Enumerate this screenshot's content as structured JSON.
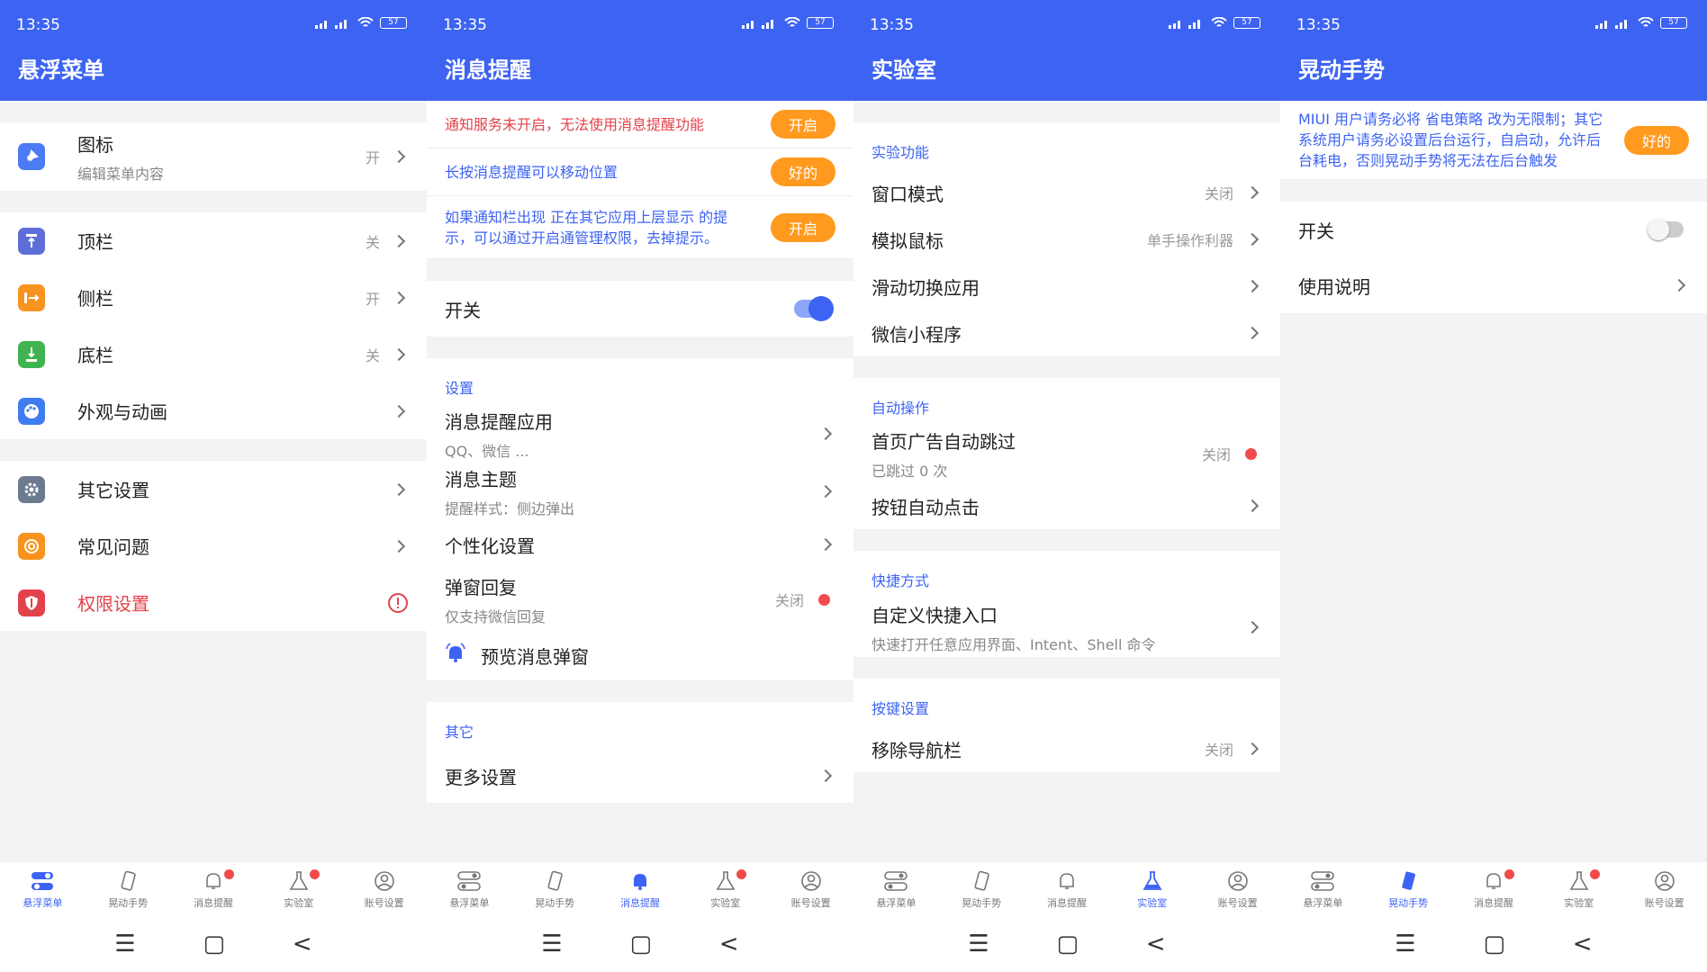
{
  "status_bar": {
    "time": "13:35",
    "battery": "57"
  },
  "colors": {
    "primary": "#3d63f3",
    "orange": "#ff9a1f",
    "red": "#f04a4a",
    "background": "#f2f3f5"
  },
  "bottom_nav": {
    "items": [
      {
        "label": "悬浮菜单",
        "icon": "toggle-menu-icon"
      },
      {
        "label": "晃动手势",
        "icon": "phone-shake-icon"
      },
      {
        "label": "消息提醒",
        "icon": "bell-icon"
      },
      {
        "label": "实验室",
        "icon": "flask-icon"
      },
      {
        "label": "账号设置",
        "icon": "account-icon"
      }
    ]
  },
  "system_nav": {
    "menu": "☰",
    "home": "▢",
    "back": "<"
  },
  "screen1": {
    "title": "悬浮菜单",
    "groups": [
      [
        {
          "title": "图标",
          "sub": "编辑菜单内容",
          "value": "开",
          "icon": "pin-icon"
        }
      ],
      [
        {
          "title": "顶栏",
          "value": "关",
          "icon": "top-bar-icon"
        },
        {
          "title": "侧栏",
          "value": "开",
          "icon": "side-bar-icon"
        },
        {
          "title": "底栏",
          "value": "关",
          "icon": "bottom-bar-icon"
        },
        {
          "title": "外观与动画",
          "value": "",
          "icon": "palette-icon"
        }
      ],
      [
        {
          "title": "其它设置",
          "value": "",
          "icon": "gear-icon"
        },
        {
          "title": "常见问题",
          "value": "",
          "icon": "lifebuoy-icon"
        },
        {
          "title": "权限设置",
          "value": "",
          "icon": "shield-icon"
        }
      ]
    ]
  },
  "screen2": {
    "title": "消息提醒",
    "notices": [
      {
        "text": "通知服务未开启，无法使用消息提醒功能",
        "button": "开启"
      },
      {
        "text": "长按消息提醒可以移动位置",
        "button": "好的"
      },
      {
        "text": "如果通知栏出现 正在其它应用上层显示 的提示，可以通过开启通管理权限，去掉提示。",
        "button": "开启"
      }
    ],
    "switch_label": "开关",
    "settings_section": "设置",
    "settings": [
      {
        "title": "消息提醒应用",
        "sub": "QQ、微信 ..."
      },
      {
        "title": "消息主题",
        "sub": "提醒样式：侧边弹出"
      },
      {
        "title": "个性化设置",
        "sub": ""
      },
      {
        "title": "弹窗回复",
        "sub": "仅支持微信回复",
        "value": "关闭"
      }
    ],
    "preview_label": "预览消息弹窗",
    "other_section": "其它",
    "more_settings": "更多设置"
  },
  "screen3": {
    "title": "实验室",
    "sections": [
      {
        "header": "实验功能",
        "items": [
          {
            "title": "窗口模式",
            "value": "关闭"
          },
          {
            "title": "模拟鼠标",
            "value": "单手操作利器"
          },
          {
            "title": "滑动切换应用",
            "value": ""
          },
          {
            "title": "微信小程序",
            "value": ""
          }
        ]
      },
      {
        "header": "自动操作",
        "items": [
          {
            "title": "首页广告自动跳过",
            "sub": "已跳过 0 次",
            "value": "关闭"
          },
          {
            "title": "按钮自动点击",
            "value": ""
          }
        ]
      },
      {
        "header": "快捷方式",
        "items": [
          {
            "title": "自定义快捷入口",
            "sub": "快速打开任意应用界面、Intent、Shell 命令",
            "value": ""
          }
        ]
      },
      {
        "header": "按键设置",
        "items": [
          {
            "title": "移除导航栏",
            "value": "关闭"
          }
        ]
      }
    ]
  },
  "screen4": {
    "title": "晃动手势",
    "notice": "MIUI 用户请务必将 省电策略 改为无限制；其它系统用户请务必设置后台运行，自启动，允许后台耗电，否则晃动手势将无法在后台触发",
    "notice_button": "好的",
    "switch_label": "开关",
    "usage_label": "使用说明"
  }
}
